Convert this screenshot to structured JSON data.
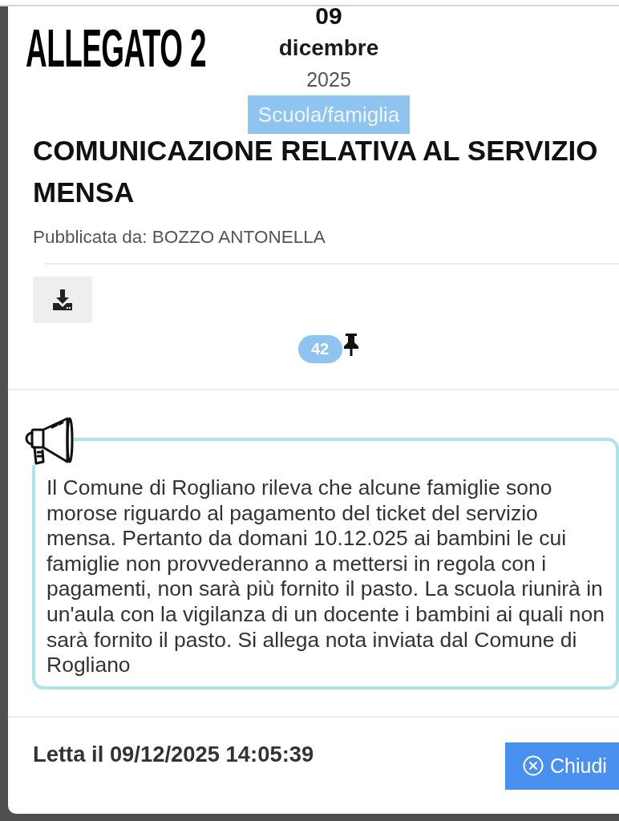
{
  "annotation": {
    "label": "ALLEGATO 2"
  },
  "date": {
    "day": "09",
    "month": "dicembre",
    "year": "2025"
  },
  "category": "Scuola/famiglia",
  "title": "COMUNICAZIONE RELATIVA AL SERVIZIO MENSA",
  "published_by": "Pubblicata da: BOZZO ANTONELLA",
  "pin_count": "42",
  "message": "Il Comune di Rogliano rileva che alcune famiglie sono morose riguardo al pagamento del ticket del servizio mensa. Pertanto da domani 10.12.025 ai bambini le cui famiglie non provvederanno a mettersi in regola con i pagamenti, non sarà più fornito il pasto. La scuola riunirà in un'aula con la vigilanza di un docente i bambini ai quali non sarà fornito il pasto. Si allega nota inviata dal Comune di Rogliano",
  "read_at": "Letta il 09/12/2025 14:05:39",
  "close_button": {
    "label": "Chiudi"
  }
}
